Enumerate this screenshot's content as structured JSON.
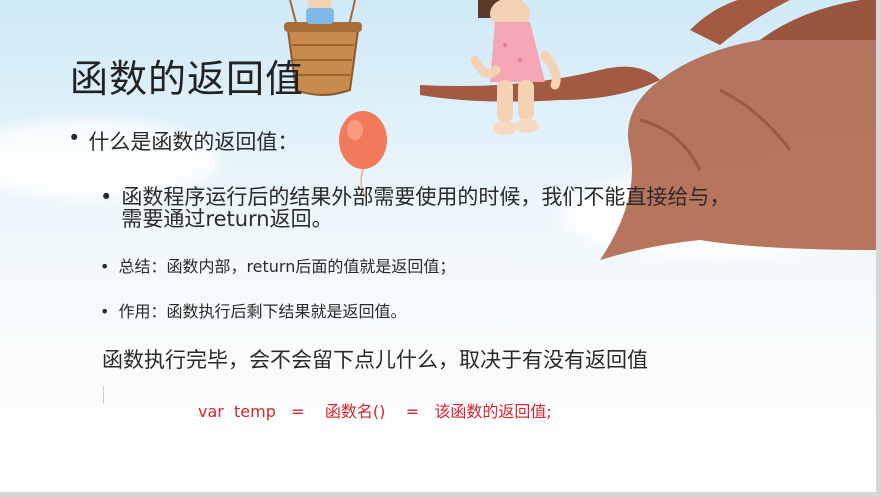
{
  "slide": {
    "title": "函数的返回值",
    "bullet_main": "什么是函数的返回值：",
    "bullet_sub1_line1": "函数程序运行后的结果外部需要使用的时候，我们不能直接给与，",
    "bullet_sub1_line2": "需要通过return返回。",
    "bullet_sub2": "总结：函数内部，return后面的值就是返回值；",
    "bullet_sub3": "作用：函数执行后剩下结果就是返回值。",
    "summary": "函数执行完毕，会不会留下点儿什么，取决于有没有返回值",
    "code": "var  temp   =    函数名()    =   该函数的返回值;",
    "bullet_symbol": "•"
  },
  "colors": {
    "code": "#d8262f",
    "text": "#2a2a2a",
    "sky_top": "#cfe9f7",
    "tree": "#b0664d",
    "balloon": "#f07a5a"
  },
  "decorations": [
    "girl-on-branch",
    "tree",
    "balloon",
    "hot-air-basket",
    "clouds"
  ]
}
